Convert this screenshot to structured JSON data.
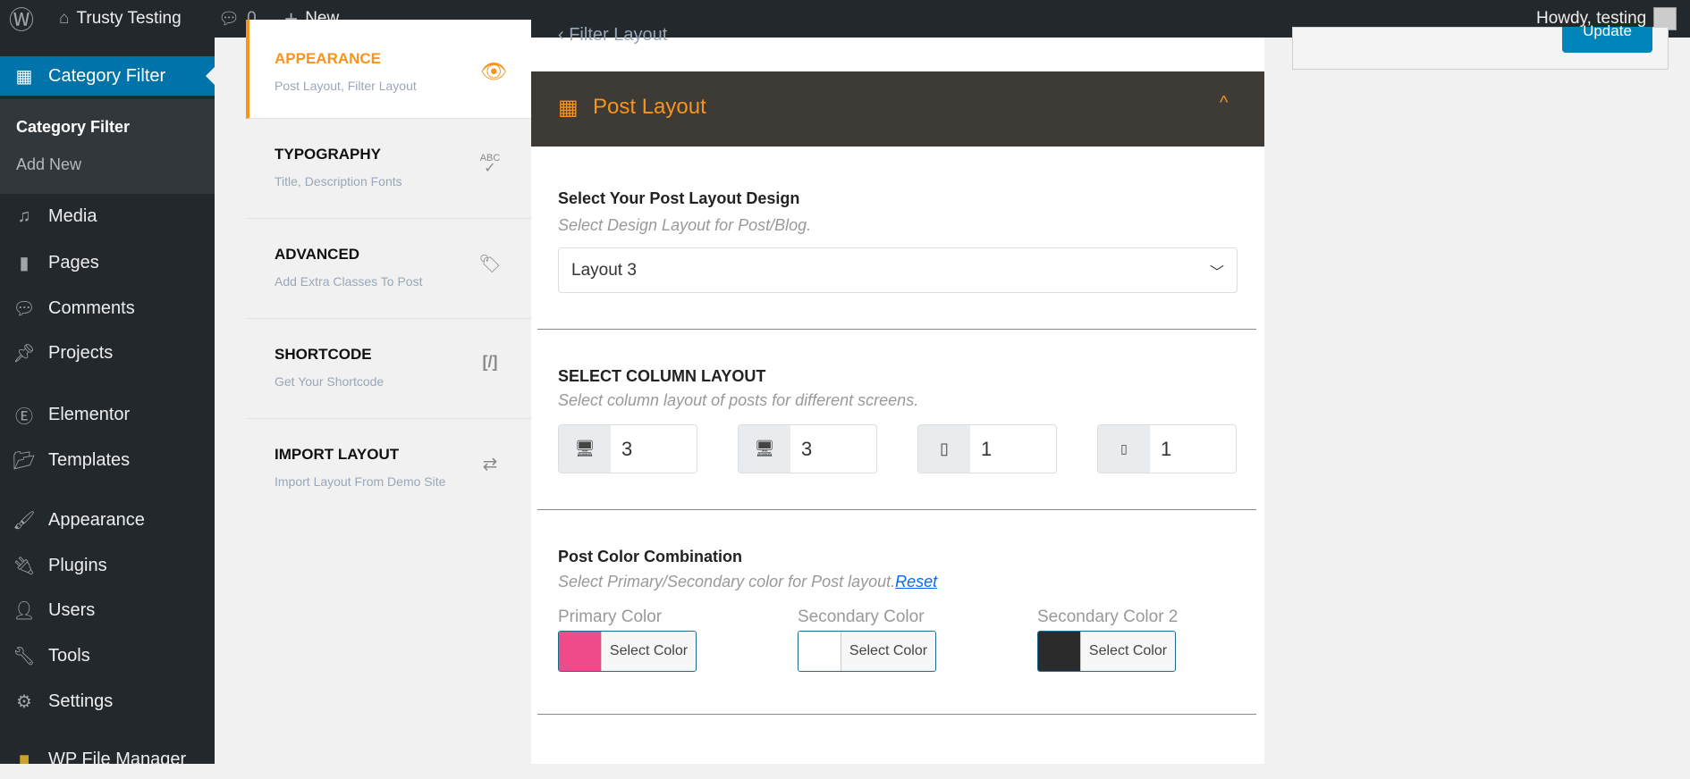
{
  "topbar": {
    "site": "Trusty Testing",
    "comments": "0",
    "new": "New",
    "greeting": "Howdy, testing"
  },
  "sidebar": {
    "active": "Category Filter",
    "submenu": [
      "Category Filter",
      "Add New"
    ],
    "items": [
      "Media",
      "Pages",
      "Comments",
      "Projects",
      "Elementor",
      "Templates",
      "Appearance",
      "Plugins",
      "Users",
      "Tools",
      "Settings",
      "WP File Manager"
    ]
  },
  "tabs": [
    {
      "title": "APPEARANCE",
      "sub": "Post Layout, Filter Layout",
      "icon": "eye-icon"
    },
    {
      "title": "TYPOGRAPHY",
      "sub": "Title, Description Fonts",
      "icon": "spellcheck-icon"
    },
    {
      "title": "ADVANCED",
      "sub": "Add Extra Classes To Post",
      "icon": "tag-icon"
    },
    {
      "title": "SHORTCODE",
      "sub": "Get Your Shortcode",
      "icon": "shortcode-icon"
    },
    {
      "title": "IMPORT LAYOUT",
      "sub": "Import Layout From Demo Site",
      "icon": "repeat-icon"
    }
  ],
  "main": {
    "prev_section": "Filter Layout",
    "section_title": "Post Layout",
    "design": {
      "title": "Select Your Post Layout Design",
      "sub": "Select Design Layout for Post/Blog.",
      "value": "Layout 3"
    },
    "columns": {
      "title": "SELECT COLUMN LAYOUT",
      "sub": "Select column layout of posts for different screens.",
      "values": [
        "3",
        "3",
        "1",
        "1"
      ]
    },
    "colors": {
      "title": "Post Color Combination",
      "sub": "Select Primary/Secondary color for Post layout.",
      "reset": "Reset",
      "button": "Select Color",
      "items": [
        {
          "label": "Primary Color",
          "color": "#ef4a8a"
        },
        {
          "label": "Secondary Color",
          "color": "#ffffff"
        },
        {
          "label": "Secondary Color 2",
          "color": "#2b2b2b"
        }
      ]
    }
  },
  "update_label": "Update",
  "colors": {
    "accent": "#f7941d",
    "wp_blue": "#0073aa"
  }
}
